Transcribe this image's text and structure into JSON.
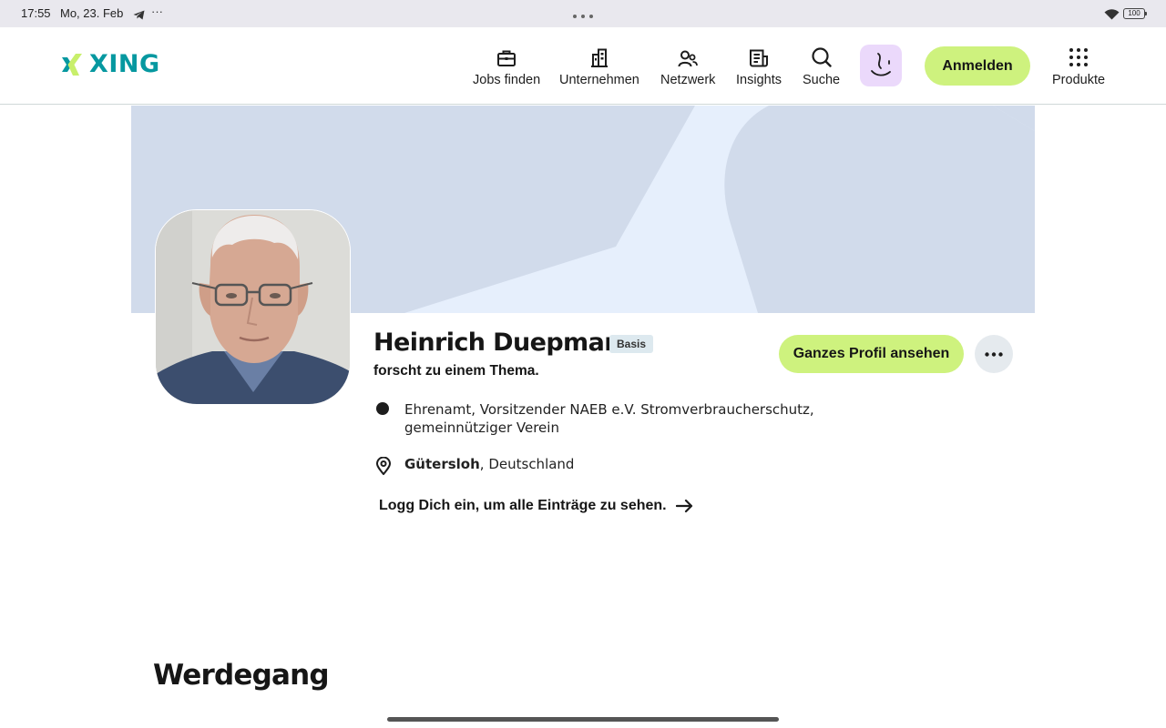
{
  "status_bar": {
    "time": "17:55",
    "date": "Mo, 23. Feb",
    "more": "···",
    "battery": "100"
  },
  "header": {
    "logo_text": "XING",
    "nav": [
      {
        "label": "Jobs finden",
        "icon": "briefcase-icon"
      },
      {
        "label": "Unternehmen",
        "icon": "building-icon"
      },
      {
        "label": "Netzwerk",
        "icon": "people-icon"
      },
      {
        "label": "Insights",
        "icon": "newspaper-icon"
      },
      {
        "label": "Suche",
        "icon": "search-icon"
      }
    ],
    "login_label": "Anmelden",
    "products_label": "Produkte"
  },
  "profile": {
    "name": "Heinrich Duepmann",
    "badge": "Basis",
    "tagline": "forscht zu einem Thema.",
    "view_profile_label": "Ganzes Profil ansehen",
    "occupation_line1": "Ehrenamt, Vorsitzender NAEB e.V. Stromverbraucherschutz,",
    "occupation_line2": "gemeinnütziger Verein",
    "city": "Gütersloh",
    "country": ", Deutschland",
    "login_hint": "Logg Dich ein, um alle Einträge zu sehen."
  },
  "sections": {
    "career_title": "Werdegang"
  },
  "colors": {
    "accent_green": "#cef27e",
    "brand_teal": "#0698a0",
    "banner_bg": "#d1dbeb",
    "ai_button_bg": "#ebd9fb"
  }
}
